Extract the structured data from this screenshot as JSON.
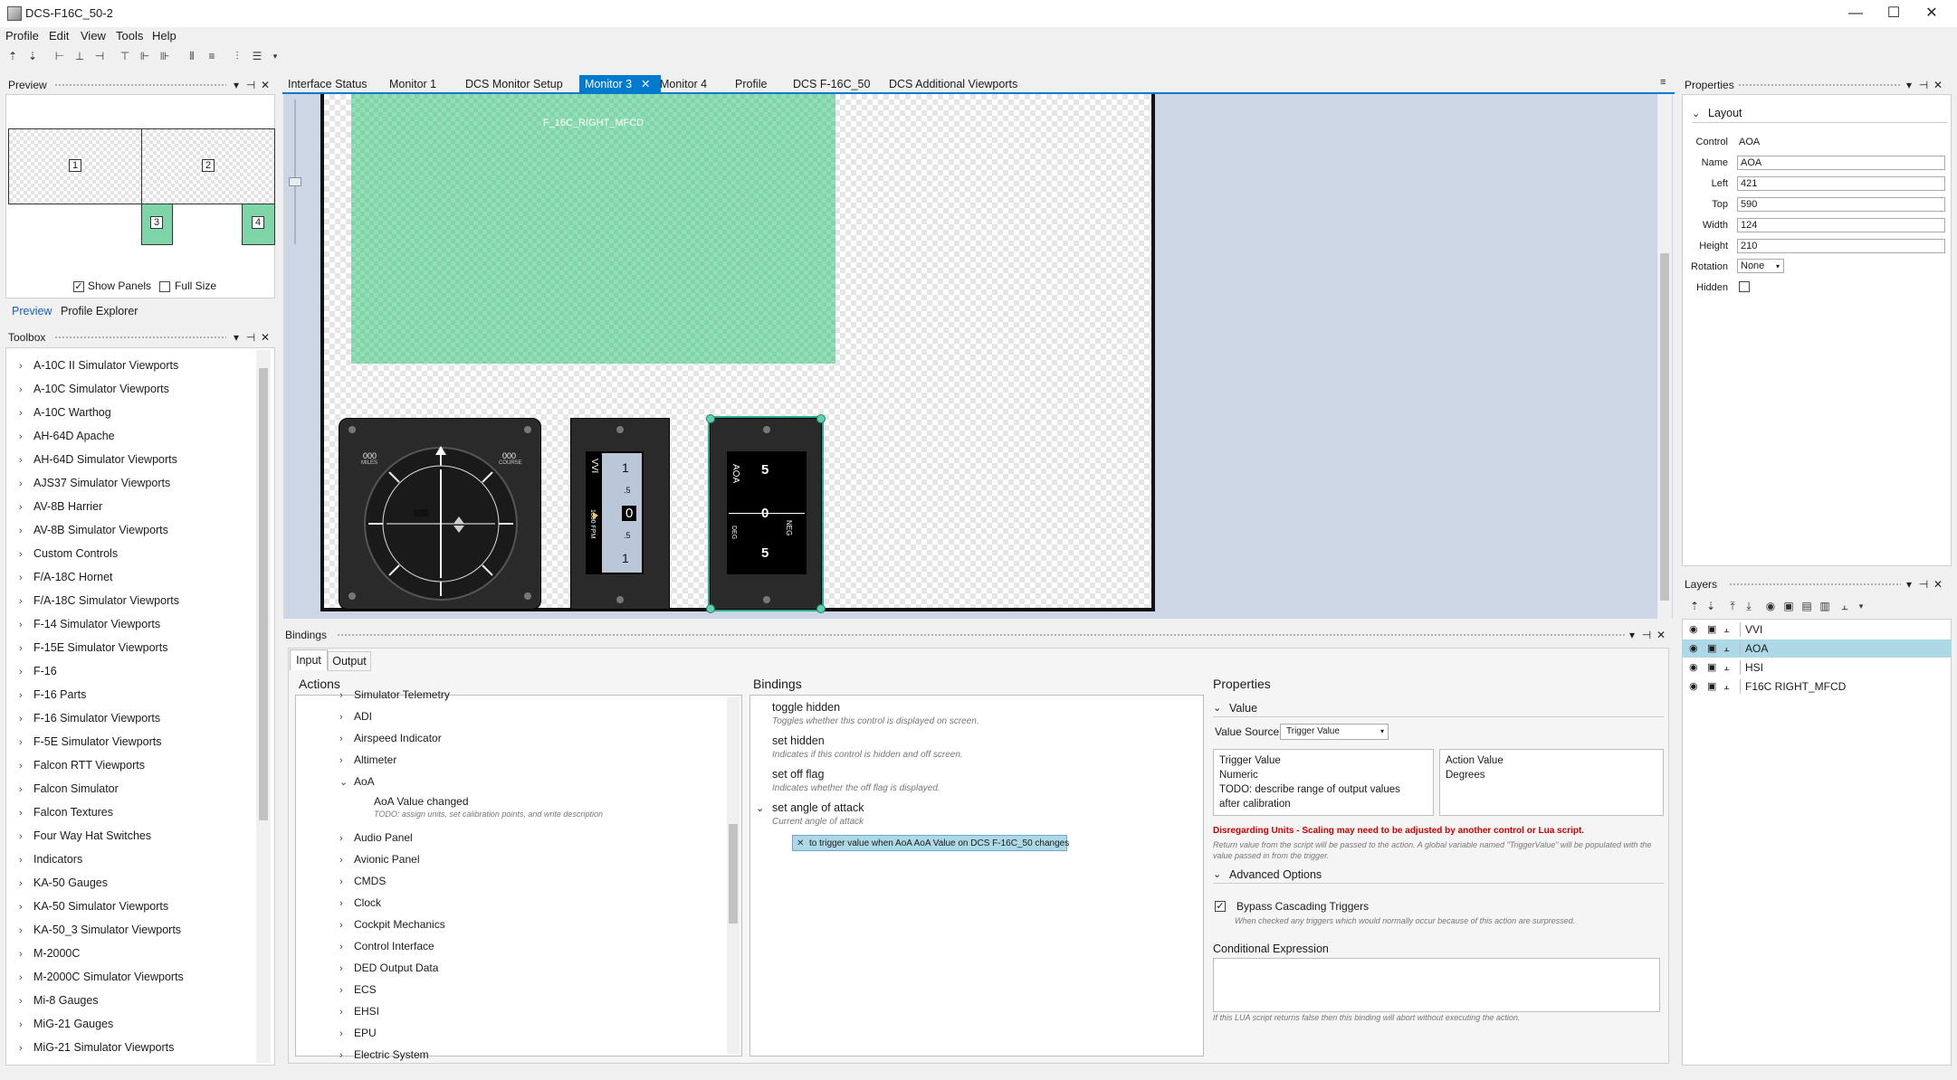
{
  "window": {
    "title": "DCS-F16C_50-2",
    "minimize": "—",
    "maximize": "☐",
    "close": "✕"
  },
  "menu": [
    "Profile",
    "Edit",
    "View",
    "Tools",
    "Help"
  ],
  "preview": {
    "header": "Preview",
    "monitors": [
      "1",
      "2",
      "3",
      "4"
    ],
    "show_panels": "Show Panels",
    "full_size": "Full Size",
    "tabs": [
      "Preview",
      "Profile Explorer"
    ]
  },
  "toolbox": {
    "header": "Toolbox",
    "items": [
      "A-10C II Simulator Viewports",
      "A-10C Simulator Viewports",
      "A-10C Warthog",
      "AH-64D Apache",
      "AH-64D Simulator Viewports",
      "AJS37 Simulator Viewports",
      "AV-8B Harrier",
      "AV-8B Simulator Viewports",
      "Custom Controls",
      "F/A-18C Hornet",
      "F/A-18C Simulator Viewports",
      "F-14 Simulator Viewports",
      "F-15E Simulator Viewports",
      "F-16",
      "F-16 Parts",
      "F-16 Simulator Viewports",
      "F-5E Simulator Viewports",
      "Falcon RTT Viewports",
      "Falcon Simulator",
      "Falcon Textures",
      "Four Way Hat Switches",
      "Indicators",
      "KA-50 Gauges",
      "KA-50 Simulator Viewports",
      "KA-50_3 Simulator Viewports",
      "M-2000C",
      "M-2000C Simulator Viewports",
      "Mi-8 Gauges",
      "MiG-21 Gauges",
      "MiG-21 Simulator Viewports"
    ]
  },
  "doc_tabs": [
    "Interface Status",
    "Monitor 1",
    "DCS Monitor Setup",
    "Monitor 3",
    "Monitor 4",
    "Profile",
    "DCS F-16C_50",
    "DCS Additional Viewports"
  ],
  "active_tab": "Monitor 3",
  "canvas": {
    "mfcd_label": "F_16C_RIGHT_MFCD",
    "hsi": {
      "miles": "000",
      "miles_label": "MILES",
      "course": "000",
      "course_label": "COURSE"
    },
    "vvi": {
      "title": "VVI",
      "sub": "1000 FPM",
      "scale": [
        "1",
        ".5",
        "0",
        ".5",
        "1"
      ]
    },
    "aoa": {
      "title": "AOA",
      "deg": "DEG",
      "neg": "NEG",
      "scale": [
        "5",
        "0",
        "5"
      ]
    }
  },
  "properties": {
    "header": "Properties",
    "section": "Layout",
    "fields": [
      {
        "label": "Control",
        "value": "AOA"
      },
      {
        "label": "Name",
        "value": "AOA"
      },
      {
        "label": "Left",
        "value": "421"
      },
      {
        "label": "Top",
        "value": "590"
      },
      {
        "label": "Width",
        "value": "124"
      },
      {
        "label": "Height",
        "value": "210"
      }
    ],
    "rotation_label": "Rotation",
    "rotation_value": "None",
    "hidden_label": "Hidden"
  },
  "layers": {
    "header": "Layers",
    "items": [
      "VVI",
      "AOA",
      "HSI",
      "F16C RIGHT_MFCD"
    ],
    "selected": "AOA"
  },
  "bindings": {
    "header": "Bindings",
    "tabs": [
      "Input",
      "Output"
    ],
    "actions_title": "Actions",
    "actions": [
      {
        "label": "Simulator Telemetry",
        "expanded": false
      },
      {
        "label": "ADI",
        "expanded": false
      },
      {
        "label": "Airspeed Indicator",
        "expanded": false
      },
      {
        "label": "Altimeter",
        "expanded": false
      },
      {
        "label": "AoA",
        "expanded": true
      },
      {
        "label": "Audio Panel",
        "expanded": false
      },
      {
        "label": "Avionic Panel",
        "expanded": false
      },
      {
        "label": "CMDS",
        "expanded": false
      },
      {
        "label": "Clock",
        "expanded": false
      },
      {
        "label": "Cockpit Mechanics",
        "expanded": false
      },
      {
        "label": "Control Interface",
        "expanded": false
      },
      {
        "label": "DED Output Data",
        "expanded": false
      },
      {
        "label": "ECS",
        "expanded": false
      },
      {
        "label": "EHSI",
        "expanded": false
      },
      {
        "label": "EPU",
        "expanded": false
      },
      {
        "label": "Electric System",
        "expanded": false
      }
    ],
    "aoa_child": {
      "label": "AoA Value changed",
      "desc": "TODO: assign units, set calibration points, and write description"
    },
    "bindings_title": "Bindings",
    "binding_items": [
      {
        "title": "toggle hidden",
        "desc": "Toggles whether this control is displayed on screen."
      },
      {
        "title": "set hidden",
        "desc": "Indicates if this control is hidden and off screen."
      },
      {
        "title": "set off flag",
        "desc": "Indicates whether the off flag is displayed."
      },
      {
        "title": "set angle of attack",
        "desc": "Current angle of attack"
      }
    ],
    "trigger_chip": "to trigger value when AoA AoA Value on DCS F-16C_50 changes",
    "properties_title": "Properties",
    "value_section": "Value",
    "value_source_label": "Value Source",
    "value_source": "Trigger Value",
    "trigger_value_lines": [
      "Trigger Value",
      "Numeric",
      "TODO: describe range of output values",
      "after calibration"
    ],
    "action_value_lines": [
      "Action Value",
      "Degrees"
    ],
    "warning": "Disregarding Units - Scaling may need to be adjusted by another control or Lua script.",
    "warning_desc": "Return value from the script will be passed to the action. A global variable named \"TriggerValue\" will be populated with the value passed in from the trigger.",
    "advanced": "Advanced Options",
    "bypass": "Bypass Cascading Triggers",
    "bypass_desc": "When checked any triggers which would normally occur because of this action are surpressed.",
    "conditional": "Conditional Expression",
    "conditional_desc": "If this LUA script returns false then this binding will abort without executing the action."
  },
  "colors": {
    "accent": "#007acc",
    "selection": "#add8e6",
    "mfcd": "#7ed6a8",
    "canvas_bg": "#cdd6e4",
    "warning": "#cc0000"
  }
}
